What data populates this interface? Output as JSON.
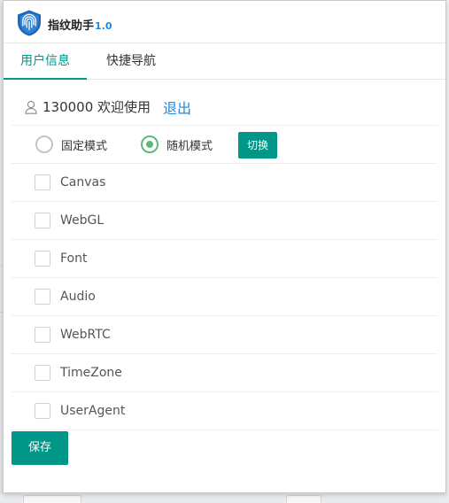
{
  "app": {
    "title": "指纹助手",
    "version": "1.0",
    "logo_icon": "shield-fingerprint-icon",
    "accent_color": "#009688",
    "link_color": "#1e88e5"
  },
  "tabs": [
    {
      "label": "用户信息",
      "active": true
    },
    {
      "label": "快捷导航",
      "active": false
    }
  ],
  "user": {
    "icon": "user-icon",
    "text": "130000 欢迎使用",
    "logout_label": "退出"
  },
  "mode": {
    "options": [
      {
        "label": "固定模式",
        "checked": false
      },
      {
        "label": "随机模式",
        "checked": true
      }
    ],
    "switch_label": "切换"
  },
  "options": [
    {
      "label": "Canvas",
      "checked": false
    },
    {
      "label": "WebGL",
      "checked": false
    },
    {
      "label": "Font",
      "checked": false
    },
    {
      "label": "Audio",
      "checked": false
    },
    {
      "label": "WebRTC",
      "checked": false
    },
    {
      "label": "TimeZone",
      "checked": false
    },
    {
      "label": "UserAgent",
      "checked": false
    }
  ],
  "save_label": "保存"
}
